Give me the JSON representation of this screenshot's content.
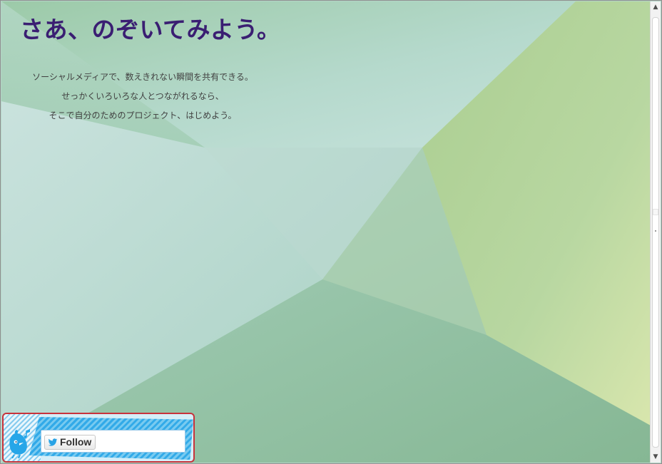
{
  "page": {
    "headline": "さあ、のぞいてみよう。",
    "lead": [
      "ソーシャルメディアで、数えきれない瞬間を共有できる。",
      "せっかくいろいろな人とつながれるなら、",
      "そこで自分のためのプロジェクト、はじめよう。"
    ]
  },
  "widget": {
    "follow_label": "Follow",
    "icons": {
      "bird": "bird-mascot-icon",
      "twitter": "twitter-icon",
      "note": "music-note-icon"
    }
  },
  "colors": {
    "headline": "#3a1e72",
    "body_text": "#414141",
    "widget_outline": "#c8323b",
    "twitter_blue": "#29a6e7"
  }
}
